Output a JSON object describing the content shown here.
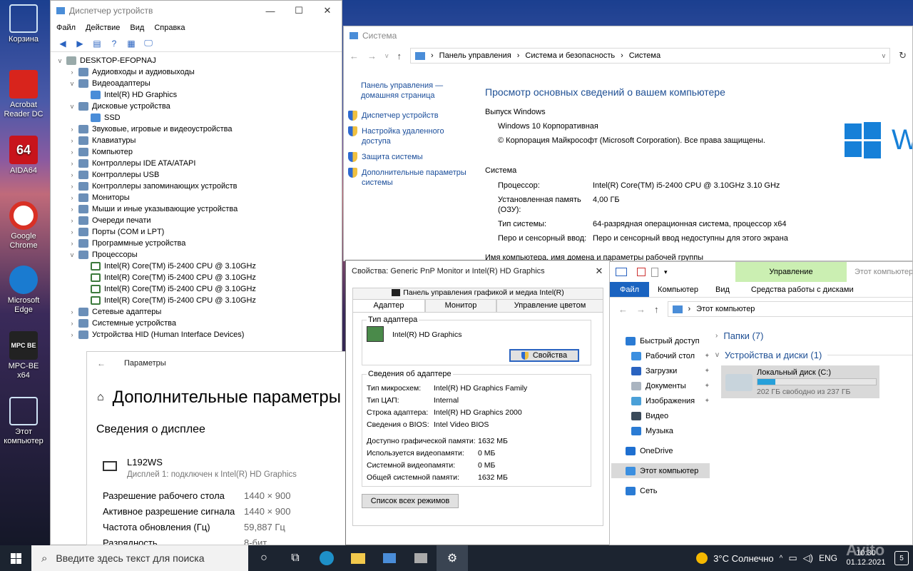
{
  "desktop": {
    "icons": [
      {
        "label": "Корзина",
        "icon": "recycle-bin-icon"
      },
      {
        "label": "Acrobat Reader DC",
        "icon": "acrobat-icon"
      },
      {
        "label": "AIDA64",
        "icon": "aida64-icon",
        "glyph": "64"
      },
      {
        "label": "Google Chrome",
        "icon": "chrome-icon"
      },
      {
        "label": "Microsoft Edge",
        "icon": "edge-icon"
      },
      {
        "label": "MPC-BE x64",
        "icon": "mpc-icon",
        "glyph": "MPC BE"
      },
      {
        "label": "Этот компьютер",
        "icon": "this-pc-icon"
      }
    ]
  },
  "devmgr": {
    "title": "Диспетчер устройств",
    "menu": [
      "Файл",
      "Действие",
      "Вид",
      "Справка"
    ],
    "root": "DESKTOP-EFOPNAJ",
    "tree": [
      {
        "label": "Аудиовходы и аудиовыходы",
        "level": 1,
        "exp": ">"
      },
      {
        "label": "Видеоадаптеры",
        "level": 1,
        "exp": "v"
      },
      {
        "label": "Intel(R) HD Graphics",
        "level": 2,
        "exp": ""
      },
      {
        "label": "Дисковые устройства",
        "level": 1,
        "exp": "v"
      },
      {
        "label": "SSD",
        "level": 2,
        "exp": ""
      },
      {
        "label": "Звуковые, игровые и видеоустройства",
        "level": 1,
        "exp": ">"
      },
      {
        "label": "Клавиатуры",
        "level": 1,
        "exp": ">"
      },
      {
        "label": "Компьютер",
        "level": 1,
        "exp": ">"
      },
      {
        "label": "Контроллеры IDE ATA/ATAPI",
        "level": 1,
        "exp": ">"
      },
      {
        "label": "Контроллеры USB",
        "level": 1,
        "exp": ">"
      },
      {
        "label": "Контроллеры запоминающих устройств",
        "level": 1,
        "exp": ">"
      },
      {
        "label": "Мониторы",
        "level": 1,
        "exp": ">"
      },
      {
        "label": "Мыши и иные указывающие устройства",
        "level": 1,
        "exp": ">"
      },
      {
        "label": "Очереди печати",
        "level": 1,
        "exp": ">"
      },
      {
        "label": "Порты (COM и LPT)",
        "level": 1,
        "exp": ">"
      },
      {
        "label": "Программные устройства",
        "level": 1,
        "exp": ">"
      },
      {
        "label": "Процессоры",
        "level": 1,
        "exp": "v"
      },
      {
        "label": "Intel(R) Core(TM) i5-2400 CPU @ 3.10GHz",
        "level": 2,
        "exp": "",
        "cpu": true
      },
      {
        "label": "Intel(R) Core(TM) i5-2400 CPU @ 3.10GHz",
        "level": 2,
        "exp": "",
        "cpu": true
      },
      {
        "label": "Intel(R) Core(TM) i5-2400 CPU @ 3.10GHz",
        "level": 2,
        "exp": "",
        "cpu": true
      },
      {
        "label": "Intel(R) Core(TM) i5-2400 CPU @ 3.10GHz",
        "level": 2,
        "exp": "",
        "cpu": true
      },
      {
        "label": "Сетевые адаптеры",
        "level": 1,
        "exp": ">"
      },
      {
        "label": "Системные устройства",
        "level": 1,
        "exp": ">"
      },
      {
        "label": "Устройства HID (Human Interface Devices)",
        "level": 1,
        "exp": ">"
      }
    ]
  },
  "system": {
    "title": "Система",
    "breadcrumb": [
      "Панель управления",
      "Система и безопасность",
      "Система"
    ],
    "sidebar_home": "Панель управления — домашняя страница",
    "sidebar_links": [
      "Диспетчер устройств",
      "Настройка удаленного доступа",
      "Защита системы",
      "Дополнительные параметры системы"
    ],
    "heading": "Просмотр основных сведений о вашем компьютере",
    "edition_header": "Выпуск Windows",
    "edition": "Windows 10 Корпоративная",
    "copyright": "© Корпорация Майкрософт (Microsoft Corporation). Все права защищены.",
    "logo_text": "W",
    "system_header": "Система",
    "rows": [
      {
        "k": "Процессор:",
        "v": "Intel(R) Core(TM) i5-2400 CPU @ 3.10GHz   3.10 GHz"
      },
      {
        "k": "Установленная память (ОЗУ):",
        "v": "4,00 ГБ"
      },
      {
        "k": "Тип системы:",
        "v": "64-разрядная операционная система, процессор x64"
      },
      {
        "k": "Перо и сенсорный ввод:",
        "v": "Перо и сенсорный ввод недоступны для этого экрана"
      }
    ],
    "computer_name_header": "Имя компьютера, имя домена и параметры рабочей группы"
  },
  "settings": {
    "title": "Параметры",
    "heading": "Дополнительные параметры",
    "section": "Сведения о дисплее",
    "monitor_name": "L192WS",
    "monitor_sub": "Дисплей 1: подключен к Intel(R) HD Graphics",
    "rows": [
      {
        "k": "Разрешение рабочего стола",
        "v": "1440 × 900"
      },
      {
        "k": "Активное разрешение сигнала",
        "v": "1440 × 900"
      },
      {
        "k": "Частота обновления (Гц)",
        "v": "59,887 Гц"
      },
      {
        "k": "Разрядность",
        "v": "8-бит"
      }
    ]
  },
  "props": {
    "title": "Свойства: Generic PnP Monitor и Intel(R) HD Graphics",
    "intel_tab": "Панель управления графикой и медиа Intel(R)",
    "tabs": [
      "Адаптер",
      "Монитор",
      "Управление цветом"
    ],
    "adapter_type_label": "Тип адаптера",
    "adapter_name": "Intel(R) HD Graphics",
    "props_button": "Свойства",
    "info_label": "Сведения об адаптере",
    "info": [
      {
        "k": "Тип микросхем:",
        "v": "Intel(R) HD Graphics Family"
      },
      {
        "k": "Тип ЦАП:",
        "v": "Internal"
      },
      {
        "k": "Строка адаптера:",
        "v": "Intel(R) HD Graphics 2000"
      },
      {
        "k": "Сведения о BIOS:",
        "v": "Intel Video BIOS"
      }
    ],
    "memory": [
      {
        "k": "Доступно графической памяти:",
        "v": "1632 МБ"
      },
      {
        "k": "Используется видеопамяти:",
        "v": "0 МБ"
      },
      {
        "k": "Системной видеопамяти:",
        "v": "0 МБ"
      },
      {
        "k": "Общей системной памяти:",
        "v": "1632 МБ"
      }
    ],
    "modes_button": "Список всех режимов"
  },
  "explorer": {
    "manage_tab": "Управление",
    "title": "Этот компьютер",
    "ribbon": [
      "Файл",
      "Компьютер",
      "Вид",
      "Средства работы с дисками"
    ],
    "address": "Этот компьютер",
    "nav": [
      {
        "label": "Быстрый доступ",
        "color": "#2a7bd4"
      },
      {
        "label": "Рабочий стол",
        "color": "#3b8fe0",
        "pin": true
      },
      {
        "label": "Загрузки",
        "color": "#2a63c0",
        "pin": true
      },
      {
        "label": "Документы",
        "color": "#aab4c0",
        "pin": true
      },
      {
        "label": "Изображения",
        "color": "#4aa0d8",
        "pin": true
      },
      {
        "label": "Видео",
        "color": "#3a4a5a"
      },
      {
        "label": "Музыка",
        "color": "#2a7bd4"
      },
      {
        "label": "OneDrive",
        "color": "#1e6fd0"
      },
      {
        "label": "Этот компьютер",
        "color": "#3b8fe0",
        "selected": true
      },
      {
        "label": "Сеть",
        "color": "#2a7bd4"
      }
    ],
    "folders_header": "Папки (7)",
    "devices_header": "Устройства и диски (1)",
    "disk_name": "Локальный диск (C:)",
    "disk_free": "202 ГБ свободно из 237 ГБ",
    "disk_used_fraction": 0.148
  },
  "taskbar": {
    "search_placeholder": "Введите здесь текст для поиска",
    "weather": "3°C  Солнечно",
    "lang": "ENG",
    "time": "10:30",
    "date": "01.12.2021",
    "notif_count": "5",
    "watermark": "Avito"
  }
}
